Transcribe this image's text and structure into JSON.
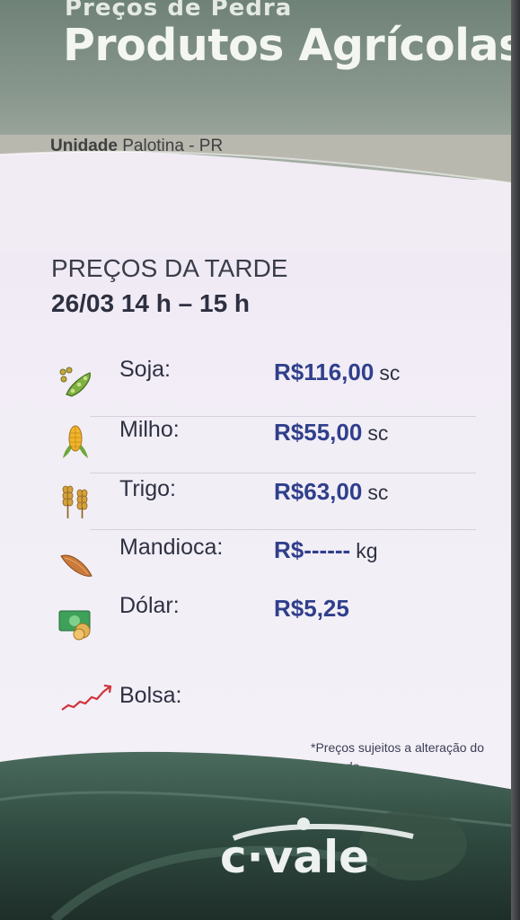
{
  "header": {
    "pretitle": "Preços de Pedra",
    "title": "Produtos Agrícolas",
    "unit_prefix": "Unidade",
    "unit_name": "Palotina - PR"
  },
  "session": {
    "title": "PREÇOS DA TARDE",
    "time": "26/03  14 h – 15 h"
  },
  "prices": [
    {
      "label": "Soja:",
      "price": "R$116,00",
      "unit": "sc",
      "icon": "soy-icon"
    },
    {
      "label": "Milho:",
      "price": "R$55,00",
      "unit": "sc",
      "icon": "corn-icon"
    },
    {
      "label": "Trigo:",
      "price": "R$63,00",
      "unit": "sc",
      "icon": "wheat-icon"
    },
    {
      "label": "Mandioca:",
      "price": "R$------",
      "unit": "kg",
      "icon": "cassava-icon"
    },
    {
      "label": "Dólar:",
      "price": "R$5,25",
      "unit": "",
      "icon": "money-icon"
    },
    {
      "label": "Bolsa:",
      "price": "",
      "unit": "",
      "icon": "trend-up-icon"
    }
  ],
  "disclaimer": "*Preços sujeitos a alteração do mercado.",
  "logo_text": "c·vale",
  "colors": {
    "price_blue": "#2f3f8c",
    "header_green": "#7d8d84",
    "footer_green": "#2f4a40"
  }
}
